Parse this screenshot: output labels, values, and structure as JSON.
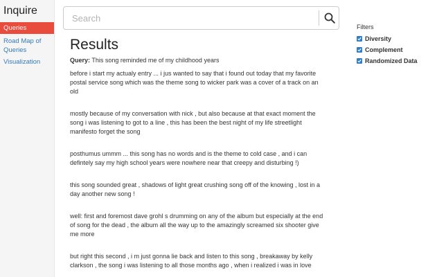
{
  "app": {
    "brand": "Inquire"
  },
  "sidebar": {
    "items": [
      {
        "label": "Queries"
      },
      {
        "label": "Road Map of Queries"
      },
      {
        "label": "Visualization"
      }
    ]
  },
  "search": {
    "placeholder": "Search",
    "value": ""
  },
  "main": {
    "title": "Results",
    "query_label": "Query:",
    "query_text": "This song reminded me of my childhood years",
    "results": [
      "before i start my actualy entry ... i jus wanted to say that i found out today that my favorite postal service song which was the theme song to wicker park was a cover of a track on an old",
      "mostly because of my conversation with nick , but also because at that exact moment the song i was listening to got to a line , this has been the best night of my life streetlight manifesto forget the song",
      "posthumus ummm ... this song has no words and is the theme to cold case , and i can defintely say my high school years were nowhere near that creepy and disturbing !)",
      "this song sounded great , shadows of light great crushing song off of the knowing , lost in a day another new song !",
      "well: first and foremost dave grohl s drumming on any of the album but especially at the end of song for the dead , the album all the way up to the amazingly screamed six shooter give me more",
      "but right this second , i m just gonna lie back and listen to this song , breakaway by kelly clarkson , the song i was listening to all those months ago , when i realized i was in love"
    ]
  },
  "filters": {
    "title": "Filters",
    "options": [
      {
        "label": "Diversity",
        "checked": true
      },
      {
        "label": "Complement",
        "checked": true
      },
      {
        "label": "Randomized Data",
        "checked": true
      }
    ]
  },
  "colors": {
    "accent": "#e84c3d",
    "link": "#337ab7",
    "checkbox": "#2f7dd1"
  }
}
